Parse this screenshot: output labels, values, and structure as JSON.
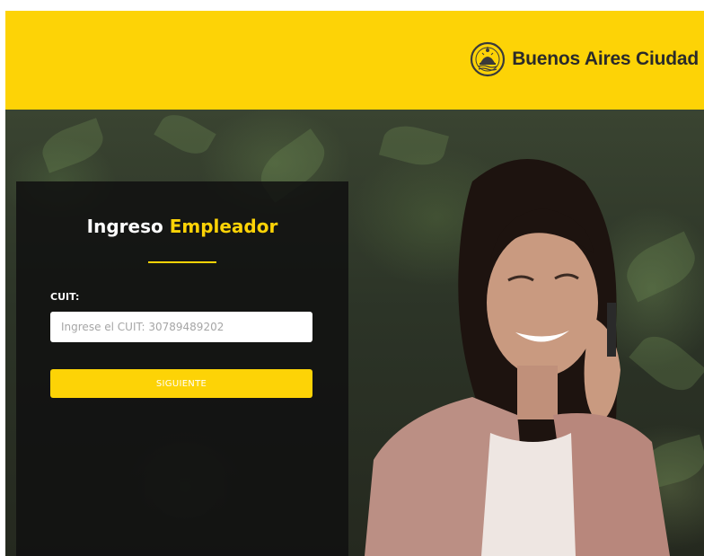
{
  "header": {
    "brand_name": "Buenos Aires Ciudad",
    "brand_icon": "city-seal-icon",
    "background_color": "#fdd306"
  },
  "hero": {
    "image_icon": "woman-on-phone-photo"
  },
  "login": {
    "title_part1": "Ingreso",
    "title_part2": "Empleador",
    "cuit_label": "CUIT:",
    "cuit_value": "",
    "cuit_placeholder": "Ingrese el CUIT: 30789489202",
    "submit_label": "SIGUIENTE",
    "accent_color": "#fdd306",
    "panel_color": "#101010"
  }
}
